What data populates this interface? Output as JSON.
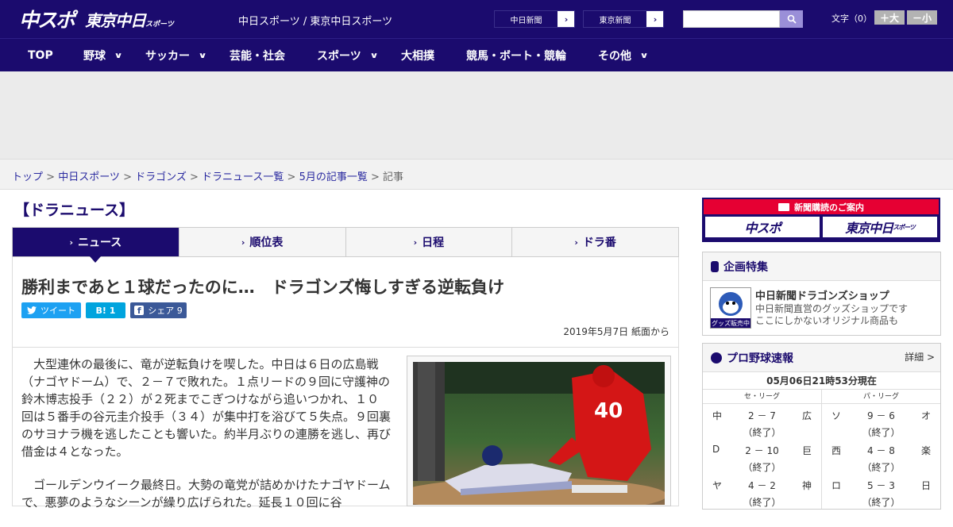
{
  "header": {
    "logo_main": "中スポ",
    "logo_tokyo": "東京中日",
    "logo_tokyo_small": "スポーツ",
    "site_links": "中日スポーツ / 東京中日スポーツ",
    "ext_links": [
      {
        "label": "中日新聞",
        "arrow": "›"
      },
      {
        "label": "東京新聞",
        "arrow": "›"
      }
    ],
    "search_placeholder": "",
    "font_size_label": "文字（0）",
    "font_plus": "＋大",
    "font_minus": "－小"
  },
  "nav": {
    "items": [
      {
        "label": "TOP",
        "has_dropdown": false
      },
      {
        "label": "野球",
        "has_dropdown": true
      },
      {
        "label": "サッカー",
        "has_dropdown": true
      },
      {
        "label": "芸能・社会",
        "has_dropdown": false
      },
      {
        "label": "スポーツ",
        "has_dropdown": true
      },
      {
        "label": "大相撲",
        "has_dropdown": false
      },
      {
        "label": "競馬・ボート・競輪",
        "has_dropdown": false
      },
      {
        "label": "その他",
        "has_dropdown": true
      }
    ],
    "dropdown_glyph": "∨"
  },
  "breadcrumb": {
    "items": [
      "トップ",
      "中日スポーツ",
      "ドラゴンズ",
      "ドラニュース一覧",
      "5月の記事一覧"
    ],
    "current": "記事",
    "separator": " > "
  },
  "section_title": "【ドラニュース】",
  "tabs": [
    {
      "label": "ニュース",
      "active": true
    },
    {
      "label": "順位表",
      "active": false
    },
    {
      "label": "日程",
      "active": false
    },
    {
      "label": "ドラ番",
      "active": false
    }
  ],
  "article": {
    "headline": "勝利まであと１球だったのに…　ドラゴンズ悔しすぎる逆転負け",
    "share_tweet": "ツイート",
    "share_hatena": "B! 1",
    "share_facebook": "シェア 9",
    "dateline": "2019年5月7日 紙面から",
    "paragraphs": [
      "大型連休の最後に、竜が逆転負けを喫した。中日は６日の広島戦（ナゴヤドーム）で、２－７で敗れた。１点リードの９回に守護神の鈴木博志投手（２２）が２死までこぎつけながら追いつかれ、１０回は５番手の谷元圭介投手（３４）が集中打を浴びて５失点。９回裏のサヨナラ機を逃したことも響いた。約半月ぶりの連勝を逃し、再び借金は４となった。",
      "ゴールデンウイーク最終日。大勢の竜党が詰めかけたナゴヤドームで、悪夢のようなシーンが繰り広げられた。延長１０回に谷"
    ],
    "photo_number": "40"
  },
  "sidebar": {
    "banner_top": "新聞購読のご案内",
    "banner_logo_1": "中スポ",
    "banner_logo_2": "東京中日",
    "banner_logo_2_small": "スポーツ",
    "feature_title": "企画特集",
    "shop_name": "中日新聞ドラゴンズショップ",
    "shop_desc_1": "中日新聞直営のグッズショップです",
    "shop_desc_2": "ここにしかないオリジナル商品も",
    "shop_badge": "グッズ販売中",
    "scores_title": "プロ野球速報",
    "scores_more": "詳細 >",
    "scores_updated": "05月06日21時53分現在",
    "league_central": "セ・リーグ",
    "league_pacific": "パ・リーグ",
    "central_games": [
      {
        "team1": "中",
        "score": "2 － 7",
        "team2": "広",
        "status": "（終了）"
      },
      {
        "team1": "D",
        "score": "2 － 10",
        "team2": "巨",
        "status": "（終了）"
      },
      {
        "team1": "ヤ",
        "score": "4 － 2",
        "team2": "神",
        "status": "（終了）"
      }
    ],
    "pacific_games": [
      {
        "team1": "ソ",
        "score": "9 － 6",
        "team2": "オ",
        "status": "（終了）"
      },
      {
        "team1": "西",
        "score": "4 － 8",
        "team2": "楽",
        "status": "（終了）"
      },
      {
        "team1": "ロ",
        "score": "5 － 3",
        "team2": "日",
        "status": "（終了）"
      }
    ]
  },
  "colors": {
    "brand_navy": "#1b0b6e",
    "twitter": "#1da1f2",
    "hatena": "#00a4de",
    "facebook": "#3b5998",
    "banner_red": "#e60033"
  }
}
